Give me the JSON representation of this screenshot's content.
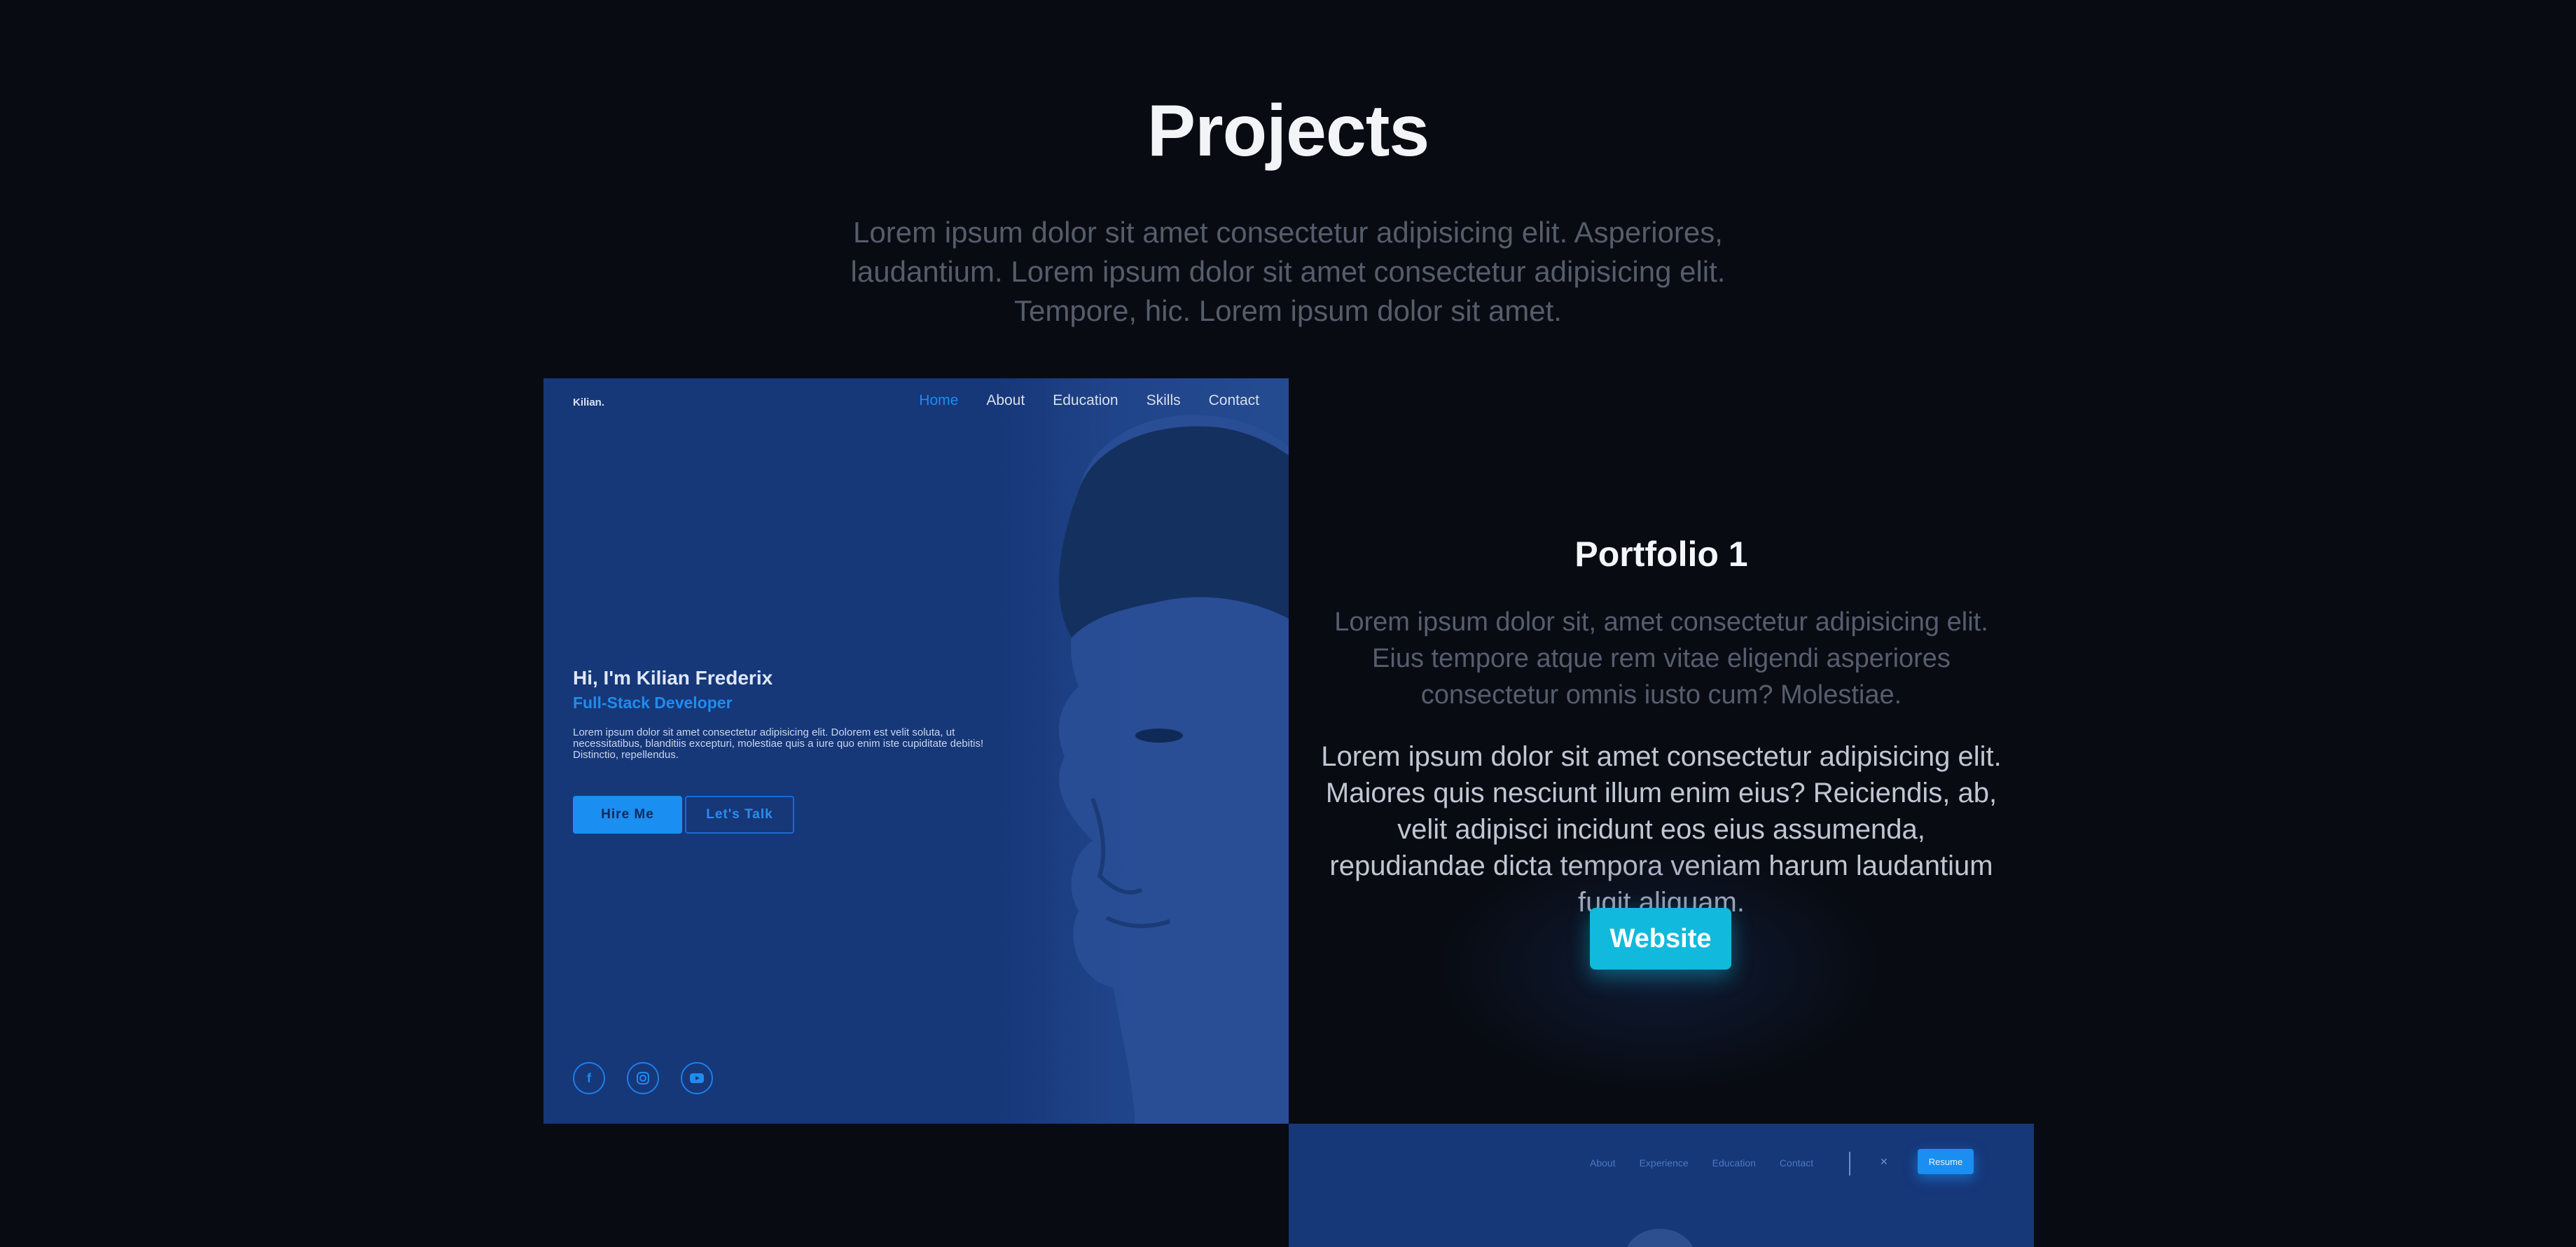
{
  "section": {
    "title": "Projects",
    "intro": "Lorem ipsum dolor sit amet consectetur adipisicing elit. Asperiores, laudantium. Lorem ipsum dolor sit amet consectetur adipisicing elit. Tempore, hic. Lorem ipsum dolor sit amet."
  },
  "project1": {
    "screenshot": {
      "logo": "Kilian.",
      "nav": [
        "Home",
        "About",
        "Education",
        "Skills",
        "Contact"
      ],
      "greeting": "Hi, I'm Kilian Frederix",
      "role": "Full-Stack Developer",
      "text": "Lorem ipsum dolor sit amet consectetur adipisicing elit. Dolorem est velit soluta, ut necessitatibus, blanditiis excepturi, molestiae quis a iure quo enim iste cupiditate debitis! Distinctio, repellendus.",
      "hire_label": "Hire Me",
      "talk_label": "Let's Talk",
      "social": [
        "facebook-icon",
        "instagram-icon",
        "youtube-icon"
      ]
    },
    "title": "Portfolio 1",
    "description": "Lorem ipsum dolor sit, amet consectetur adipisicing elit. Eius tempore atque rem vitae eligendi asperiores consectetur omnis iusto cum? Molestiae.",
    "detail": "Lorem ipsum dolor sit amet consectetur adipisicing elit. Maiores quis nesciunt illum enim eius? Reiciendis, ab, velit adipisci incidunt eos eius assumenda, repudiandae dicta tempora veniam harum laudantium fugit aliquam.",
    "website_label": "Website"
  },
  "project2": {
    "screenshot": {
      "nav": [
        "About",
        "Experience",
        "Education",
        "Contact"
      ],
      "close": "✕",
      "resume_label": "Resume"
    }
  },
  "colors": {
    "background": "#080b12",
    "accent": "#1b8ef2",
    "website_button": "#11b9dd",
    "screenshot_bg": "#163778"
  }
}
